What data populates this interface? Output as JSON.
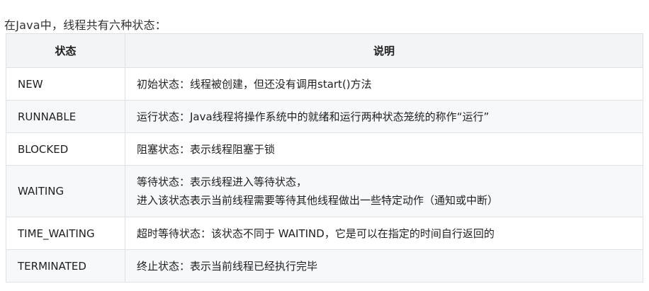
{
  "intro": "在Java中，线程共有六种状态：",
  "table": {
    "headers": [
      "状态",
      "说明"
    ],
    "rows": [
      {
        "state": "NEW",
        "desc": [
          "初始状态：线程被创建，但还没有调用start()方法"
        ]
      },
      {
        "state": "RUNNABLE",
        "desc": [
          "运行状态：Java线程将操作系统中的就绪和运行两种状态笼统的称作“运行”"
        ]
      },
      {
        "state": "BLOCKED",
        "desc": [
          "阻塞状态：表示线程阻塞于锁"
        ]
      },
      {
        "state": "WAITING",
        "desc": [
          "等待状态：表示线程进入等待状态，",
          "进入该状态表示当前线程需要等待其他线程做出一些特定动作（通知或中断）"
        ]
      },
      {
        "state": "TIME_WAITING",
        "desc": [
          "超时等待状态：该状态不同于 WAITIND，它是可以在指定的时间自行返回的"
        ]
      },
      {
        "state": "TERMINATED",
        "desc": [
          "终止状态：表示当前线程已经执行完毕"
        ]
      }
    ]
  },
  "colors": {
    "header_bg": "#f3f4f6",
    "alt_row_bg": "#f7f8fa",
    "border": "#dfe2e5"
  }
}
